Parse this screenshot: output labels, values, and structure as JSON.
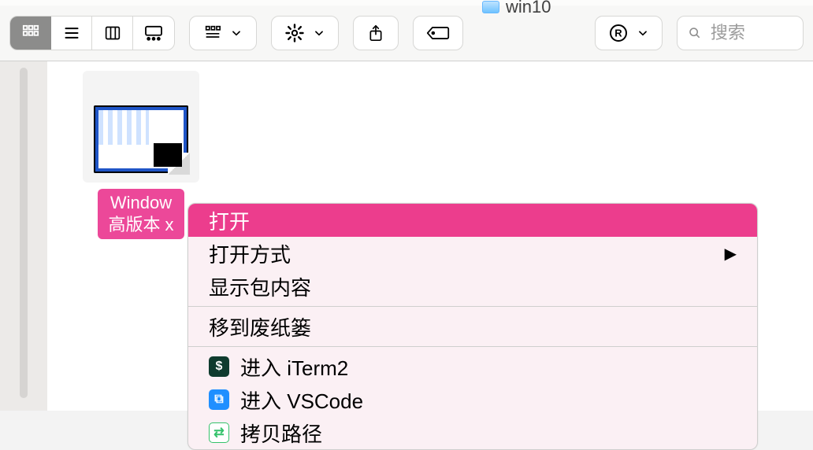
{
  "window": {
    "folder_name": "win10"
  },
  "toolbar": {
    "view_modes": [
      "icon",
      "list",
      "column",
      "gallery"
    ],
    "selected_view": 0,
    "search_placeholder": "搜索"
  },
  "file": {
    "name_line1": "Window",
    "name_line2": "高版本 x"
  },
  "context_menu": {
    "selected_index": 0,
    "groups": [
      {
        "items": [
          {
            "label": "打开",
            "type": "plain"
          },
          {
            "label": "打开方式",
            "type": "submenu"
          },
          {
            "label": "显示包内容",
            "type": "plain"
          }
        ]
      },
      {
        "items": [
          {
            "label": "移到废纸篓",
            "type": "plain"
          }
        ]
      },
      {
        "items": [
          {
            "label": "进入 iTerm2",
            "type": "icon",
            "icon": "iterm",
            "icon_bg": "#0f3b2e",
            "icon_glyph": "$"
          },
          {
            "label": "进入 VSCode",
            "type": "icon",
            "icon": "vscode",
            "icon_bg": "#1f8fff",
            "icon_glyph": "⧉"
          },
          {
            "label": "拷贝路径",
            "type": "icon",
            "icon": "copy-path",
            "icon_bg": "#ffffff",
            "icon_fg": "#35c26b",
            "icon_glyph": "⇄"
          }
        ]
      }
    ]
  }
}
